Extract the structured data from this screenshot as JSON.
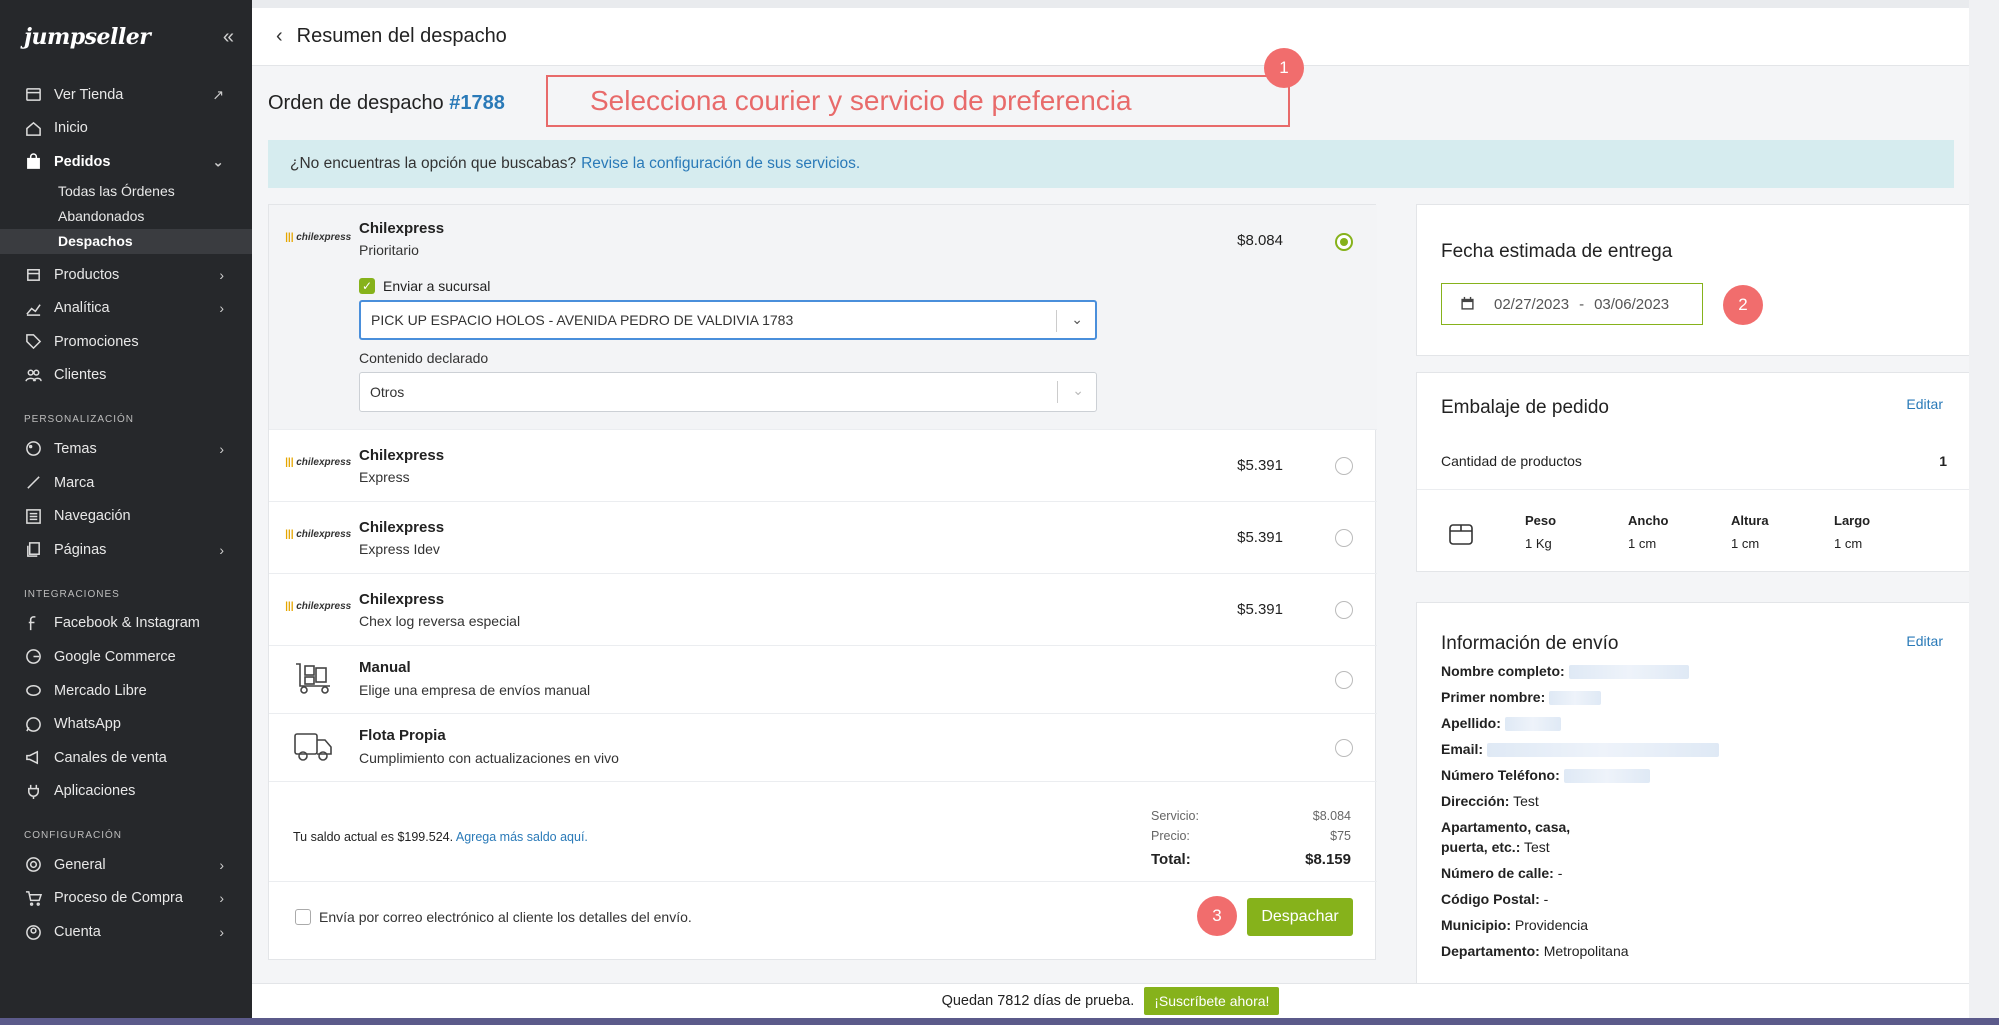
{
  "sidebar": {
    "logo": "jumpseller",
    "nav": {
      "ver_tienda": "Ver Tienda",
      "inicio": "Inicio",
      "pedidos": "Pedidos",
      "pedidos_sub": [
        "Todas las Órdenes",
        "Abandonados",
        "Despachos"
      ],
      "productos": "Productos",
      "analitica": "Analítica",
      "promociones": "Promociones",
      "clientes": "Clientes",
      "section_personalizacion": "PERSONALIZACIÓN",
      "temas": "Temas",
      "marca": "Marca",
      "navegacion": "Navegación",
      "paginas": "Páginas",
      "section_integraciones": "INTEGRACIONES",
      "facebook": "Facebook & Instagram",
      "google": "Google Commerce",
      "mercado": "Mercado Libre",
      "whatsapp": "WhatsApp",
      "canales": "Canales de venta",
      "aplicaciones": "Aplicaciones",
      "section_configuracion": "CONFIGURACIÓN",
      "general": "General",
      "proceso": "Proceso de Compra",
      "cuenta": "Cuenta"
    }
  },
  "header": {
    "title": "Resumen del despacho"
  },
  "order": {
    "label": "Orden de despacho",
    "number": "#1788"
  },
  "annotations": {
    "box_text": "Selecciona courier y servicio de preferencia",
    "badge1": "1",
    "badge2": "2",
    "badge3": "3"
  },
  "info": {
    "text": "¿No encuentras la opción que buscabas?",
    "link": "Revise la configuración de sus servicios."
  },
  "options": [
    {
      "logo": "chilexpress",
      "name": "Chilexpress",
      "service": "Prioritario",
      "price": "$8.084",
      "selected": true
    },
    {
      "logo": "chilexpress",
      "name": "Chilexpress",
      "service": "Express",
      "price": "$5.391",
      "selected": false
    },
    {
      "logo": "chilexpress",
      "name": "Chilexpress",
      "service": "Express Idev",
      "price": "$5.391",
      "selected": false
    },
    {
      "logo": "chilexpress",
      "name": "Chilexpress",
      "service": "Chex log reversa especial",
      "price": "$5.391",
      "selected": false
    },
    {
      "icon": "dolly-icon",
      "name": "Manual",
      "service": "Elige una empresa de envíos manual",
      "selected": false
    },
    {
      "icon": "truck-icon",
      "name": "Flota Propia",
      "service": "Cumplimiento con actualizaciones en vivo",
      "selected": false
    }
  ],
  "selected_details": {
    "checkbox_label": "Enviar a sucursal",
    "branch_value": "PICK UP ESPACIO HOLOS - AVENIDA PEDRO DE VALDIVIA 1783",
    "content_label": "Contenido declarado",
    "content_value": "Otros"
  },
  "balance": {
    "text": "Tu saldo actual es $199.524.",
    "link": "Agrega más saldo aquí."
  },
  "totals": {
    "servicio_label": "Servicio:",
    "servicio": "$8.084",
    "precio_label": "Precio:",
    "precio": "$75",
    "total_label": "Total:",
    "total": "$8.159"
  },
  "footer": {
    "email_label": "Envía por correo electrónico al cliente los detalles del envío.",
    "dispatch": "Despachar"
  },
  "delivery": {
    "title": "Fecha estimada de entrega",
    "from": "02/27/2023",
    "sep": "-",
    "to": "03/06/2023"
  },
  "packaging": {
    "title": "Embalaje de pedido",
    "edit": "Editar",
    "qty_label": "Cantidad de productos",
    "qty": "1",
    "dims": [
      {
        "label": "Peso",
        "value": "1 Kg"
      },
      {
        "label": "Ancho",
        "value": "1 cm"
      },
      {
        "label": "Altura",
        "value": "1 cm"
      },
      {
        "label": "Largo",
        "value": "1 cm"
      }
    ]
  },
  "shipping": {
    "title": "Información de envío",
    "edit": "Editar",
    "nombre_completo": "Nombre completo:",
    "primer_nombre": "Primer nombre:",
    "apellido": "Apellido:",
    "email": "Email:",
    "telefono": "Número Teléfono:",
    "direccion_label": "Dirección:",
    "direccion": "Test",
    "apartamento_label": "Apartamento, casa,",
    "apartamento_label2": "puerta, etc.:",
    "apartamento": "Test",
    "calle_label": "Número de calle:",
    "calle": "-",
    "postal_label": "Código Postal:",
    "postal": "-",
    "municipio_label": "Municipio:",
    "municipio": "Providencia",
    "departamento_label": "Departamento:",
    "departamento": "Metropolitana"
  },
  "trial": {
    "text": "Quedan 7812 días de prueba.",
    "cta": "¡Suscríbete ahora!"
  }
}
